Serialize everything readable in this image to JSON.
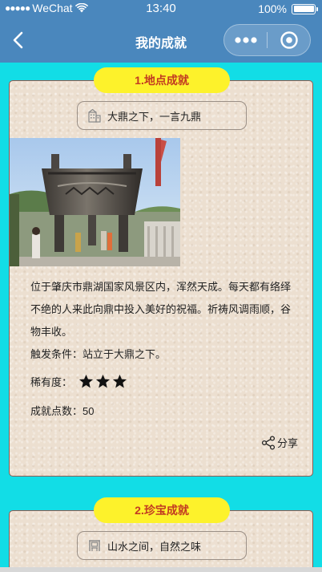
{
  "status_bar": {
    "signal": "●●●●●",
    "carrier": "WeChat",
    "time": "13:40",
    "battery": "100%",
    "battery_level": 1.0
  },
  "nav": {
    "title": "我的成就",
    "back_icon": "chevron-left-icon",
    "more_icon": "ellipsis-icon",
    "close_icon": "target-icon"
  },
  "colors": {
    "nav_bg": "#4a87bd",
    "page_bg": "#12dde6",
    "tag_bg": "#fdf22b",
    "tag_text": "#c23b22",
    "card_border": "#8f5b52"
  },
  "achievements": [
    {
      "tag": "1.地点成就",
      "subtitle": "大鼎之下，一言九鼎",
      "subtitle_icon": "building-icon",
      "description": "位于肇庆市鼎湖国家风景区内，浑然天成。每天都有络绎不绝的人来此向鼎中投入美好的祝福。祈祷风调雨顺，谷物丰收。",
      "trigger": "触发条件：站立于大鼎之下。",
      "rarity_label": "稀有度：",
      "rarity_stars": 3,
      "points": "成就点数：50",
      "share": "分享"
    },
    {
      "tag": "2.珍宝成就",
      "subtitle": "山水之间，自然之味",
      "subtitle_icon": "bench-icon"
    }
  ]
}
